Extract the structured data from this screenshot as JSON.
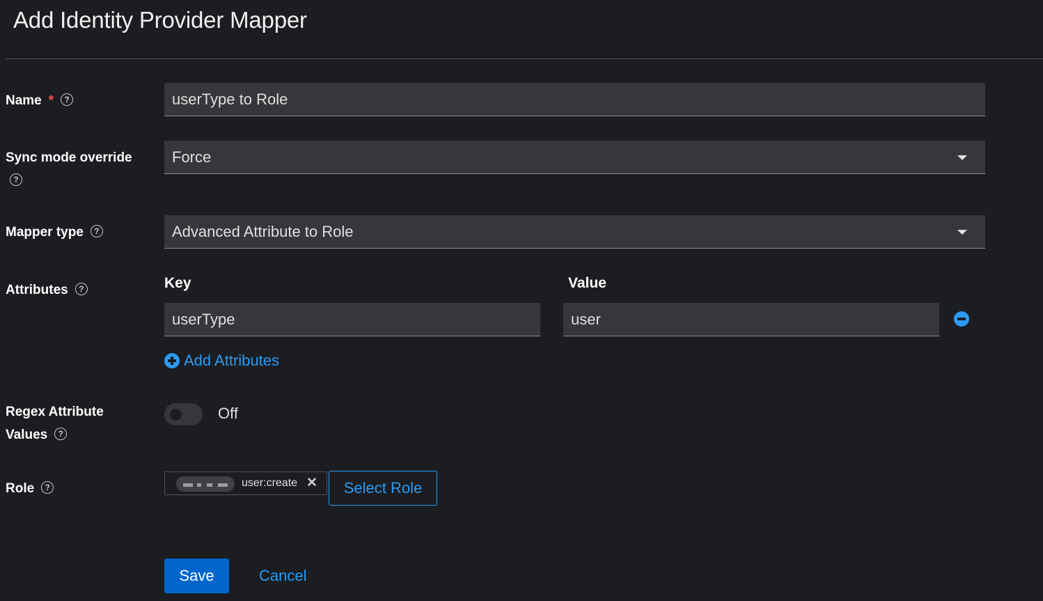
{
  "page": {
    "title": "Add Identity Provider Mapper"
  },
  "form": {
    "name": {
      "label": "Name",
      "required_mark": "*",
      "help_icon": "help-icon",
      "value": "userType to Role"
    },
    "sync_mode": {
      "label": "Sync mode override",
      "help_icon": "help-icon",
      "selected": "Force"
    },
    "mapper_type": {
      "label": "Mapper type",
      "help_icon": "help-icon",
      "selected": "Advanced Attribute to Role"
    },
    "attributes": {
      "label": "Attributes",
      "help_icon": "help-icon",
      "key_header": "Key",
      "value_header": "Value",
      "rows": [
        {
          "key": "userType",
          "value": "user"
        }
      ],
      "remove_icon": "minus-circle-icon",
      "add_label": "Add Attributes",
      "add_icon": "plus-circle-icon"
    },
    "regex": {
      "label_line1": "Regex Attribute",
      "label_line2": "Values",
      "help_icon": "help-icon",
      "state": "Off",
      "on": false
    },
    "role": {
      "label": "Role",
      "help_icon": "help-icon",
      "chip_text": "user:create",
      "chip_close_icon": "close-icon",
      "select_button": "Select Role"
    }
  },
  "actions": {
    "save": "Save",
    "cancel": "Cancel"
  },
  "colors": {
    "background": "#1b1d21",
    "field_background": "#36373a",
    "link_blue": "#2b9af3",
    "primary_button": "#0066cc",
    "required_red": "#fe5142"
  }
}
